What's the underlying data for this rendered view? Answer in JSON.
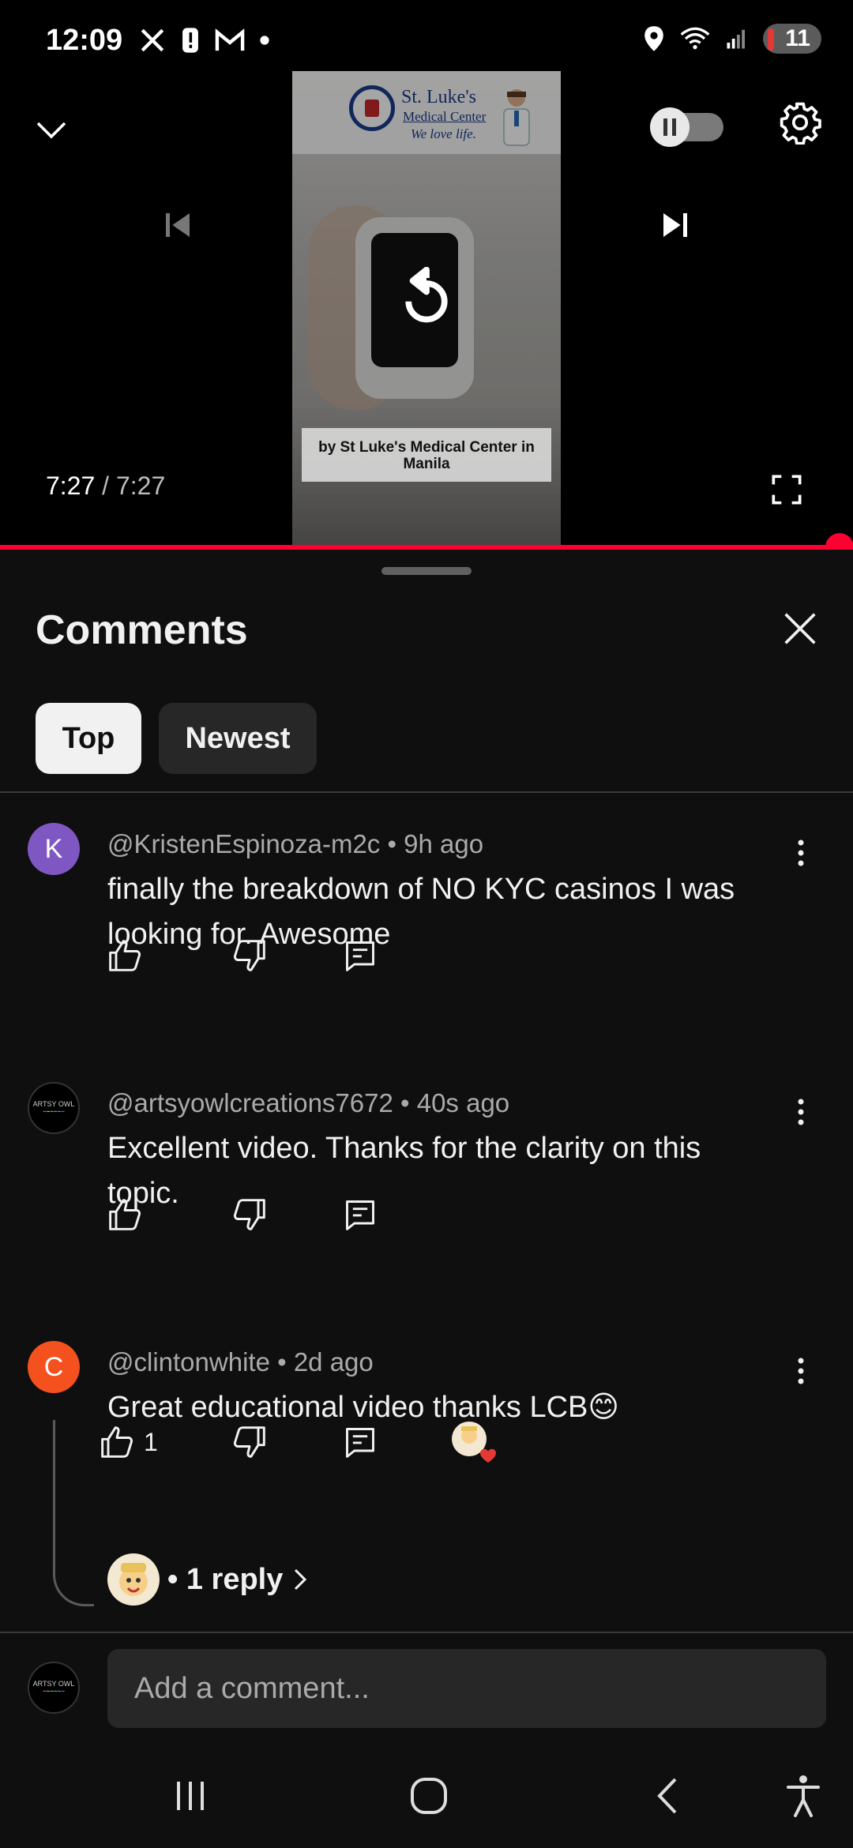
{
  "status_bar": {
    "time": "12:09",
    "battery": "11",
    "left_icons": [
      "x-icon",
      "alert-icon",
      "gmail-icon",
      "dot-icon"
    ],
    "right_icons": [
      "location-icon",
      "wifi-icon",
      "signal-icon",
      "battery-icon"
    ]
  },
  "player": {
    "current_time": "7:27",
    "separator": "/",
    "duration": "7:27",
    "progress": 1.0,
    "video": {
      "logo_line1": "St. Luke's",
      "logo_line2": "Medical Center",
      "logo_tagline": "We love life.",
      "caption": "by St Luke's Medical Center in Manila"
    }
  },
  "comments_panel": {
    "title": "Comments",
    "chips": [
      {
        "label": "Top",
        "selected": true
      },
      {
        "label": "Newest",
        "selected": false
      }
    ],
    "comments": [
      {
        "avatar_letter": "K",
        "avatar_color": "#7e57c2",
        "header": "@KristenEspinoza-m2c • 9h ago",
        "text": "finally the breakdown of NO KYC casinos I was looking for. Awesome",
        "likes": ""
      },
      {
        "avatar_letter": "",
        "avatar_text": "ARTSY OWL",
        "avatar_color": "#000000",
        "header": "@artsyowlcreations7672 • 40s ago",
        "text": "Excellent video.  Thanks for the clarity on this topic.",
        "likes": ""
      },
      {
        "avatar_letter": "C",
        "avatar_color": "#f4511e",
        "header": "@clintonwhite • 2d ago",
        "text": "Great educational video thanks LCB😊",
        "likes": "1",
        "creator_hearted": true,
        "replies_label": "• 1 reply"
      }
    ]
  },
  "add_comment": {
    "placeholder": "Add a comment...",
    "avatar_text": "ARTSY OWL"
  },
  "colors": {
    "background": "#0f0f0f",
    "accent_red": "#ff0033",
    "chip_selected": "#f1f1f1",
    "chip_unselected": "#272727"
  }
}
